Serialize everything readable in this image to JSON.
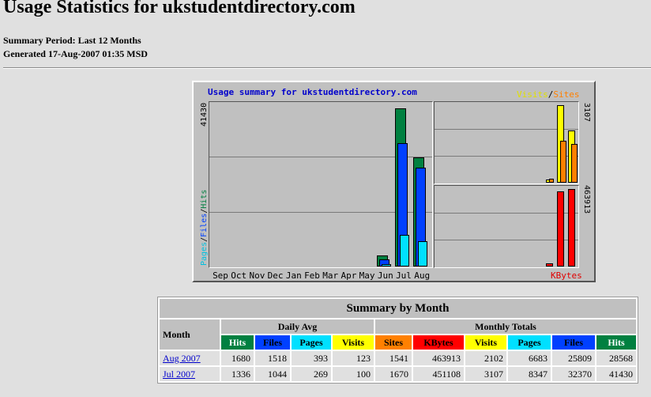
{
  "page": {
    "title": "Usage Statistics for ukstudentdirectory.com",
    "summary_period": "Summary Period: Last 12 Months",
    "generated": "Generated 17-Aug-2007 01:35 MSD"
  },
  "colors": {
    "hits": "#008040",
    "files": "#0040ff",
    "pages": "#00e0ff",
    "visits": "#ffff00",
    "sites": "#ff8000",
    "kbytes": "#ff0000"
  },
  "chart": {
    "title": "Usage summary for ukstudentdirectory.com",
    "left_axis_max": "41430",
    "right_top_max": "3107",
    "right_bottom_max": "463913",
    "left_legend": {
      "pages": "Pages",
      "sep1": "/",
      "files": "Files",
      "sep2": "/",
      "hits": "Hits"
    },
    "right_legend": {
      "visits": "Visits",
      "sep": "/",
      "sites": "Sites"
    },
    "kbytes_label": "KBytes"
  },
  "chart_data": {
    "type": "bar",
    "title": "Usage summary for ukstudentdirectory.com",
    "categories": [
      "Sep",
      "Oct",
      "Nov",
      "Dec",
      "Jan",
      "Feb",
      "Mar",
      "Apr",
      "May",
      "Jun",
      "Jul",
      "Aug"
    ],
    "series": [
      {
        "name": "Hits",
        "values": [
          0,
          0,
          0,
          0,
          0,
          0,
          0,
          0,
          0,
          3000,
          41430,
          28568
        ]
      },
      {
        "name": "Files",
        "values": [
          0,
          0,
          0,
          0,
          0,
          0,
          0,
          0,
          0,
          1900,
          32370,
          25809
        ]
      },
      {
        "name": "Pages",
        "values": [
          0,
          0,
          0,
          0,
          0,
          0,
          0,
          0,
          0,
          700,
          8347,
          6683
        ]
      },
      {
        "name": "Visits",
        "values": [
          0,
          0,
          0,
          0,
          0,
          0,
          0,
          0,
          0,
          0,
          3107,
          2102
        ]
      },
      {
        "name": "Sites",
        "values": [
          0,
          0,
          0,
          0,
          0,
          0,
          0,
          0,
          0,
          0,
          1670,
          1541
        ]
      },
      {
        "name": "KBytes",
        "values": [
          0,
          0,
          0,
          0,
          0,
          0,
          0,
          0,
          0,
          0,
          451108,
          463913
        ]
      }
    ],
    "extra_small_bars": {
      "Jun": {
        "visits": 120,
        "sites": 150,
        "kbytes": 18000
      }
    },
    "ylim_hits": [
      0,
      41430
    ],
    "ylim_visits": [
      0,
      3107
    ],
    "ylim_kbytes": [
      0,
      463913
    ]
  },
  "table": {
    "caption": "Summary by Month",
    "month_header": "Month",
    "daily_avg_header": "Daily Avg",
    "monthly_totals_header": "Monthly Totals",
    "columns": [
      "Hits",
      "Files",
      "Pages",
      "Visits",
      "Sites",
      "KBytes",
      "Visits",
      "Pages",
      "Files",
      "Hits"
    ],
    "rows": [
      {
        "month": "Aug 2007",
        "values": [
          "1680",
          "1518",
          "393",
          "123",
          "1541",
          "463913",
          "2102",
          "6683",
          "25809",
          "28568"
        ]
      },
      {
        "month": "Jul 2007",
        "values": [
          "1336",
          "1044",
          "269",
          "100",
          "1670",
          "451108",
          "3107",
          "8347",
          "32370",
          "41430"
        ]
      }
    ]
  }
}
